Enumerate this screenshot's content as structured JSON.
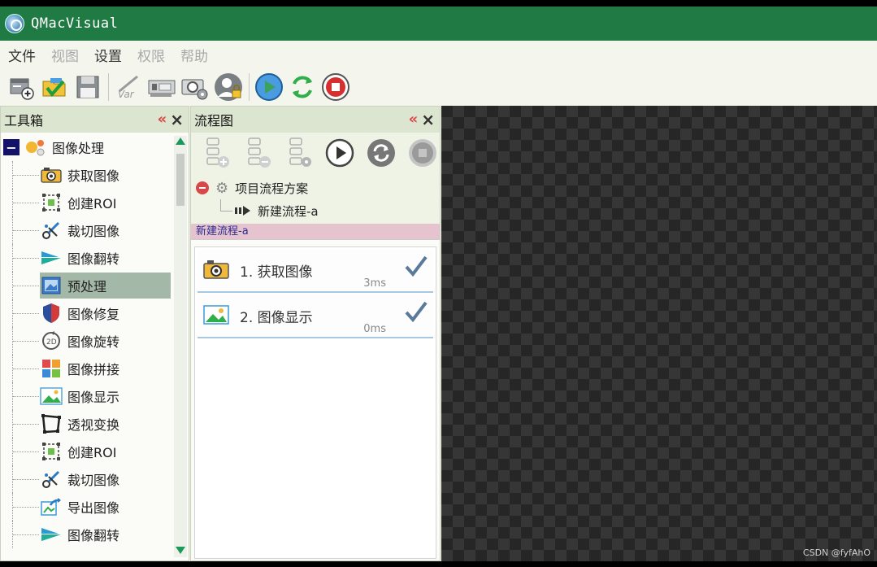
{
  "window": {
    "title": "QMacVisual"
  },
  "menu": [
    {
      "label": "文件",
      "enabled": true
    },
    {
      "label": "视图",
      "enabled": false
    },
    {
      "label": "设置",
      "enabled": true
    },
    {
      "label": "权限",
      "enabled": false
    },
    {
      "label": "帮助",
      "enabled": false
    }
  ],
  "toolbar": {
    "icons": [
      "new-solution-icon",
      "open-folder-icon",
      "save-icon",
      "variable-icon",
      "camera-card-icon",
      "camera-settings-icon",
      "user-lock-icon",
      "run-icon",
      "loop-run-icon",
      "stop-icon"
    ]
  },
  "toolbox": {
    "title": "工具箱",
    "root": "图像处理",
    "items": [
      {
        "label": "获取图像",
        "icon": "camera-icon"
      },
      {
        "label": "创建ROI",
        "icon": "roi-icon"
      },
      {
        "label": "裁切图像",
        "icon": "scissors-icon"
      },
      {
        "label": "图像翻转",
        "icon": "flip-icon"
      },
      {
        "label": "预处理",
        "icon": "preprocess-icon",
        "selected": true
      },
      {
        "label": "图像修复",
        "icon": "shield-icon"
      },
      {
        "label": "图像旋转",
        "icon": "rotate-icon"
      },
      {
        "label": "图像拼接",
        "icon": "puzzle-icon"
      },
      {
        "label": "图像显示",
        "icon": "picture-icon"
      },
      {
        "label": "透视变换",
        "icon": "perspective-icon"
      },
      {
        "label": "创建ROI",
        "icon": "roi-icon"
      },
      {
        "label": "裁切图像",
        "icon": "scissors-icon"
      },
      {
        "label": "导出图像",
        "icon": "export-icon"
      },
      {
        "label": "图像翻转",
        "icon": "flip-icon"
      }
    ]
  },
  "flow": {
    "title": "流程图",
    "scheme": "项目流程方案",
    "process": "新建流程-a",
    "tab": "新建流程-a",
    "steps": [
      {
        "label": "1. 获取图像",
        "time": "3ms",
        "icon": "camera-icon"
      },
      {
        "label": "2. 图像显示",
        "time": "0ms",
        "icon": "picture-icon"
      }
    ]
  },
  "watermark": "CSDN @fyfAhO",
  "colors": {
    "titlebar": "#1f7a43",
    "selection": "#a4b8a8",
    "tab": "#e5c3cf"
  }
}
